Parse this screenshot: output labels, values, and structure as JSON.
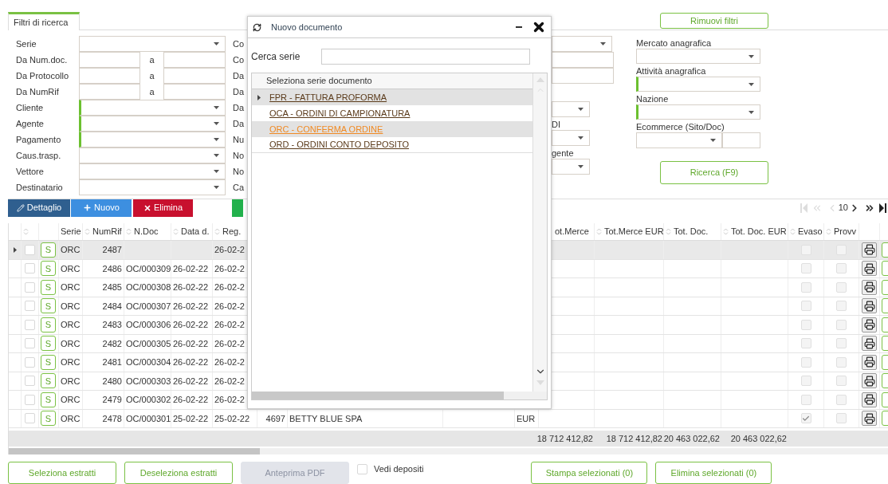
{
  "filter_panel": {
    "tab": {
      "label": "Filtri di ricerca",
      "selected": true
    },
    "clear_button": "Rimuovi filtri",
    "search_button": "Ricerca (F9)",
    "fields": [
      {
        "label": "Serie",
        "kind": "select",
        "highlighted": false
      },
      {
        "label": "Da Num.doc.",
        "kind": "range",
        "separator": "a"
      },
      {
        "label": "Da Protocollo",
        "kind": "range",
        "separator": "a"
      },
      {
        "label": "Da NumRif",
        "kind": "range",
        "separator": "a"
      },
      {
        "label": "Cliente",
        "kind": "select",
        "highlighted": true
      },
      {
        "label": "Agente",
        "kind": "select",
        "highlighted": true
      },
      {
        "label": "Pagamento",
        "kind": "select",
        "highlighted": true
      },
      {
        "label": "Caus.trasp.",
        "kind": "select",
        "highlighted": false
      },
      {
        "label": "Vettore",
        "kind": "select",
        "highlighted": false
      },
      {
        "label": "Destinatario",
        "kind": "select",
        "highlighted": false
      }
    ],
    "fields_column_2": [
      "Co",
      "Co",
      "Da",
      "Da",
      "Da",
      "Da",
      "Nu",
      "No",
      "No",
      "Ca"
    ],
    "fields_column_3": [
      {
        "kind": "select"
      },
      {
        "kind": "input"
      },
      {
        "kind": "input"
      },
      {
        "kind": "select"
      },
      {
        "label": "DI",
        "kind": "select"
      },
      {
        "label": "gente",
        "kind": "select"
      }
    ],
    "fields_column_4": [
      {
        "label": "Mercato anagrafica",
        "kind": "select",
        "highlighted": false
      },
      {
        "label": "Attività anagrafica",
        "kind": "select",
        "highlighted": true
      },
      {
        "label": "Nazione",
        "kind": "select",
        "highlighted": true
      },
      {
        "label": "Ecommerce (Sito/Doc)",
        "kind": "select_input",
        "highlighted": false
      }
    ]
  },
  "toolbar": {
    "buttons": [
      {
        "label": "Dettaglio",
        "kind": "detail"
      },
      {
        "label": "Nuovo",
        "kind": "new"
      },
      {
        "label": "Elimina",
        "kind": "delete"
      },
      {
        "kind": "other"
      }
    ],
    "pager": {
      "page_size": "10"
    }
  },
  "table": {
    "headers": [
      {
        "sortable": true
      },
      {
        "label": "Serie",
        "sortable": false
      },
      {
        "label": "NumRif",
        "sortable": true
      },
      {
        "label": "N.Doc",
        "sortable": true
      },
      {
        "label": "Data d.",
        "sortable": true
      },
      {
        "label": "Reg.",
        "sortable": true
      },
      {
        "label": "ot.Merce",
        "sortable": false
      },
      {
        "label": "Tot.Merce EUR",
        "sortable": true
      },
      {
        "label": "Tot. Doc.",
        "sortable": true
      },
      {
        "label": "Tot. Doc. EUR",
        "sortable": true
      },
      {
        "label": "Evaso",
        "sortable": true
      },
      {
        "label": "Provv",
        "sortable": true
      }
    ],
    "rows": [
      {
        "selected": true,
        "checked": false,
        "badge": "S",
        "cells": [
          "ORC",
          "2487",
          null,
          null,
          "26-02-2"
        ],
        "evaso": false,
        "provv": false
      },
      {
        "selected": false,
        "checked": false,
        "badge": "S",
        "cells": [
          "ORC",
          "2486",
          "OC/000309",
          "26-02-22",
          "26-02-2"
        ],
        "evaso": false,
        "provv": false
      },
      {
        "selected": false,
        "checked": false,
        "badge": "S",
        "cells": [
          "ORC",
          "2485",
          "OC/000308",
          "26-02-22",
          "26-02-2"
        ],
        "evaso": false,
        "provv": false
      },
      {
        "selected": false,
        "checked": false,
        "badge": "S",
        "cells": [
          "ORC",
          "2484",
          "OC/000307",
          "26-02-22",
          "26-02-2"
        ],
        "evaso": false,
        "provv": false
      },
      {
        "selected": false,
        "checked": false,
        "badge": "S",
        "cells": [
          "ORC",
          "2483",
          "OC/000306",
          "26-02-22",
          "26-02-2"
        ],
        "evaso": false,
        "provv": false
      },
      {
        "selected": false,
        "checked": false,
        "badge": "S",
        "cells": [
          "ORC",
          "2482",
          "OC/000305",
          "26-02-22",
          "26-02-2"
        ],
        "evaso": false,
        "provv": false
      },
      {
        "selected": false,
        "checked": false,
        "badge": "S",
        "cells": [
          "ORC",
          "2481",
          "OC/000304",
          "26-02-22",
          "26-02-2"
        ],
        "evaso": false,
        "provv": false
      },
      {
        "selected": false,
        "checked": false,
        "badge": "S",
        "cells": [
          "ORC",
          "2480",
          "OC/000303",
          "26-02-22",
          "26-02-2"
        ],
        "evaso": false,
        "provv": false
      },
      {
        "selected": false,
        "checked": false,
        "badge": "S",
        "cells": [
          "ORC",
          "2479",
          "OC/000302",
          "26-02-22",
          "26-02-2"
        ],
        "evaso": false,
        "provv": false
      },
      {
        "selected": false,
        "checked": false,
        "badge": "S",
        "cells": [
          "ORC",
          "2478",
          "OC/000301",
          "25-02-22",
          "25-02-22",
          "4697",
          "BETTY BLUE SPA",
          null,
          "EUR"
        ],
        "evaso": true,
        "provv": false
      }
    ],
    "totals": [
      "18 712 412,82",
      "18 712 412,82",
      "20 463 022,62",
      "20 463 022,62"
    ]
  },
  "dialog": {
    "title": "Nuovo documento",
    "search_label": "Cerca serie",
    "list_header": "Seleziona serie documento",
    "items": [
      {
        "label": "FPR - FATTURA PROFORMA",
        "selected": true,
        "hovered": false
      },
      {
        "label": "OCA - ORDINI DI CAMPIONATURA",
        "selected": false,
        "hovered": false
      },
      {
        "label": "ORC - CONFERMA ORDINE",
        "selected": false,
        "hovered": true
      },
      {
        "label": "ORD - ORDINI CONTO DEPOSITO",
        "selected": false,
        "hovered": false
      }
    ]
  },
  "bottom_bar": {
    "buttons_left": [
      {
        "label": "Seleziona estratti",
        "disabled": false
      },
      {
        "label": "Deseleziona estratti",
        "disabled": false
      },
      {
        "label": "Anteprima PDF",
        "disabled": true
      }
    ],
    "deposits_checkbox": {
      "label": "Vedi depositi",
      "checked": false
    },
    "buttons_right": [
      {
        "label": "Stampa selezionati (0)",
        "disabled": false
      },
      {
        "label": "Elimina selezionati (0)",
        "disabled": false
      }
    ]
  }
}
